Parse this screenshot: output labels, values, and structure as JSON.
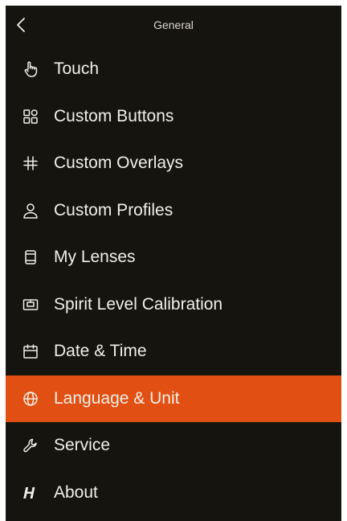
{
  "header": {
    "title": "General"
  },
  "menu": {
    "items": [
      {
        "label": "Touch",
        "icon": "touch-hand-icon"
      },
      {
        "label": "Custom Buttons",
        "icon": "grid-icon"
      },
      {
        "label": "Custom Overlays",
        "icon": "hash-icon"
      },
      {
        "label": "Custom Profiles",
        "icon": "user-icon"
      },
      {
        "label": "My Lenses",
        "icon": "lens-icon"
      },
      {
        "label": "Spirit Level Calibration",
        "icon": "level-icon"
      },
      {
        "label": "Date & Time",
        "icon": "calendar-icon"
      },
      {
        "label": "Language & Unit",
        "icon": "globe-icon",
        "selected": true
      },
      {
        "label": "Service",
        "icon": "wrench-icon"
      },
      {
        "label": "About",
        "icon": "h-logo-icon"
      }
    ]
  },
  "colors": {
    "background": "#16140f",
    "accent": "#e15012",
    "text": "#f2efe9"
  }
}
